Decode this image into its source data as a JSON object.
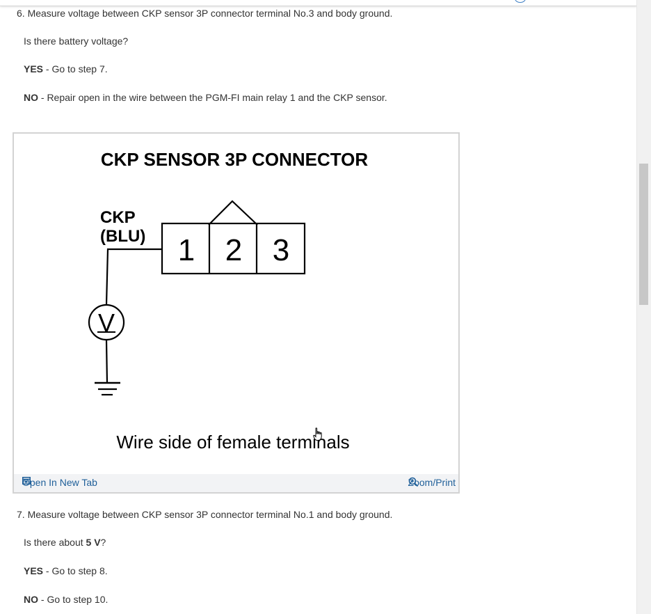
{
  "step6": {
    "instruction": "6. Measure voltage between CKP sensor 3P connector terminal No.3 and body ground.",
    "question": "Is there battery voltage?",
    "yes_label": "YES",
    "yes_text": " - Go to step 7.",
    "no_label": "NO",
    "no_text": " - Repair open in the wire between the PGM-FI main relay 1 and the CKP sensor."
  },
  "figure": {
    "title": "CKP SENSOR 3P CONNECTOR",
    "wire_label_1": "CKP",
    "wire_label_2": "(BLU)",
    "terminals": [
      "1",
      "2",
      "3"
    ],
    "meter_symbol": "V",
    "caption": "Wire side of female terminals",
    "open_new_tab": "Open In New Tab",
    "zoom_print": "Zoom/Print"
  },
  "step7": {
    "instruction": "7. Measure voltage between CKP sensor 3P connector terminal No.1 and body ground.",
    "question_prefix": "Is there about ",
    "question_value": "5 V",
    "question_suffix": "?",
    "yes_label": "YES",
    "yes_text": " - Go to step 8.",
    "no_label": "NO",
    "no_text": " - Go to step 10."
  },
  "colors": {
    "text": "#333333",
    "link": "#1f5f99",
    "figure_border": "#d3d3d3",
    "figure_bar": "#f2f3f5"
  }
}
